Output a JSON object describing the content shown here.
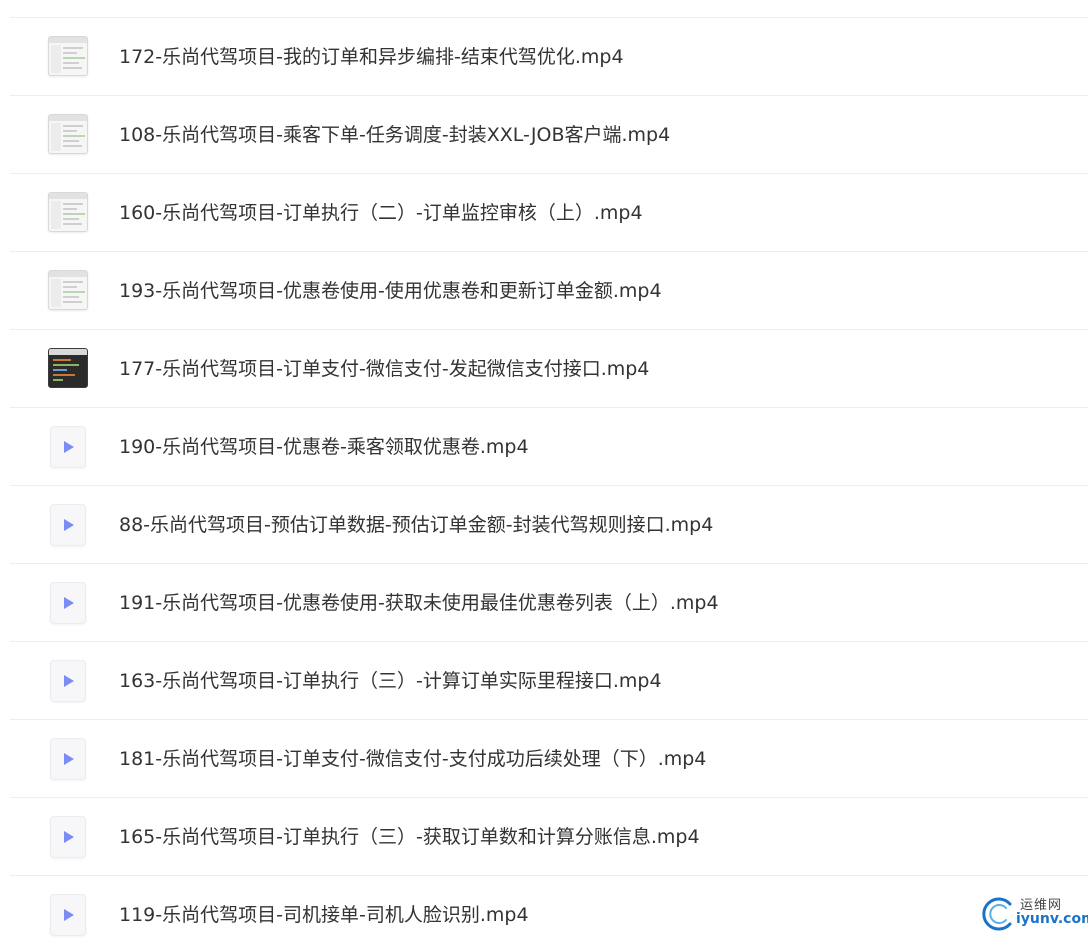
{
  "files": [
    {
      "name": "172-乐尚代驾项目-我的订单和异步编排-结束代驾优化.mp4",
      "thumbnail": "screenshot-light"
    },
    {
      "name": "108-乐尚代驾项目-乘客下单-任务调度-封装XXL-JOB客户端.mp4",
      "thumbnail": "screenshot-light"
    },
    {
      "name": "160-乐尚代驾项目-订单执行（二）-订单监控审核（上）.mp4",
      "thumbnail": "screenshot-light"
    },
    {
      "name": "193-乐尚代驾项目-优惠卷使用-使用优惠卷和更新订单金额.mp4",
      "thumbnail": "screenshot-light"
    },
    {
      "name": "177-乐尚代驾项目-订单支付-微信支付-发起微信支付接口.mp4",
      "thumbnail": "screenshot-dark"
    },
    {
      "name": "190-乐尚代驾项目-优惠卷-乘客领取优惠卷.mp4",
      "thumbnail": "video-play-icon"
    },
    {
      "name": "88-乐尚代驾项目-预估订单数据-预估订单金额-封装代驾规则接口.mp4",
      "thumbnail": "video-play-icon"
    },
    {
      "name": "191-乐尚代驾项目-优惠卷使用-获取未使用最佳优惠卷列表（上）.mp4",
      "thumbnail": "video-play-icon"
    },
    {
      "name": "163-乐尚代驾项目-订单执行（三）-计算订单实际里程接口.mp4",
      "thumbnail": "video-play-icon"
    },
    {
      "name": "181-乐尚代驾项目-订单支付-微信支付-支付成功后续处理（下）.mp4",
      "thumbnail": "video-play-icon"
    },
    {
      "name": "165-乐尚代驾项目-订单执行（三）-获取订单数和计算分账信息.mp4",
      "thumbnail": "video-play-icon"
    },
    {
      "name": "119-乐尚代驾项目-司机接单-司机人脸识别.mp4",
      "thumbnail": "video-play-icon"
    }
  ],
  "watermark": {
    "site_name": "运维网",
    "domain": "iyunv.com"
  },
  "colors": {
    "text": "#333333",
    "divider": "#eeeeee",
    "play_icon": "#7b8cf2",
    "watermark_blue": "#1a73c8"
  }
}
